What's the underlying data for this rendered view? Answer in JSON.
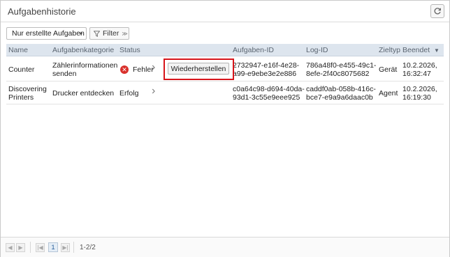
{
  "window": {
    "title": "Aufgabenhistorie",
    "refresh_icon": "refresh-icon"
  },
  "toolbar": {
    "view_select": "Nur erstellte Aufgaben",
    "filter_label": "Filter"
  },
  "table": {
    "columns": [
      "Name",
      "Aufgabenkategorie",
      "Status",
      "Aufgaben-ID",
      "Log-ID",
      "Zieltyp",
      "Beendet"
    ],
    "sort_column": "Beendet",
    "rows": [
      {
        "name": "Counter",
        "category": [
          "Zählerinformationen",
          "senden"
        ],
        "status": "Fehler",
        "status_color": "#d9302b",
        "action": "Wiederherstellen",
        "task_id": [
          "2732947-e16f-4e28-",
          "a99-e9ebe3e2e886"
        ],
        "log_id": [
          "786a48f0-e455-49c1-",
          "8efe-2f40c8075682"
        ],
        "target": "Gerät",
        "finished": [
          "10.2.2026,",
          "16:32:47"
        ]
      },
      {
        "name": [
          "Discovering",
          "Printers"
        ],
        "category": [
          "Drucker entdecken"
        ],
        "status": "Erfolg",
        "task_id": [
          "c0a64c98-d694-40da-",
          "93d1-3c55e9eee925"
        ],
        "log_id": [
          "caddf0ab-058b-416c-",
          "bce7-e9a9a6daac0b"
        ],
        "target": "Agent",
        "finished": [
          "10.2.2026,",
          "16:19:30"
        ]
      }
    ]
  },
  "pagination": {
    "current_page": "1",
    "range": "1-2/2"
  },
  "colors": {
    "accent": "#2e7bd6",
    "highlight": "#d7141a",
    "header_bg": "#dde5ee"
  }
}
